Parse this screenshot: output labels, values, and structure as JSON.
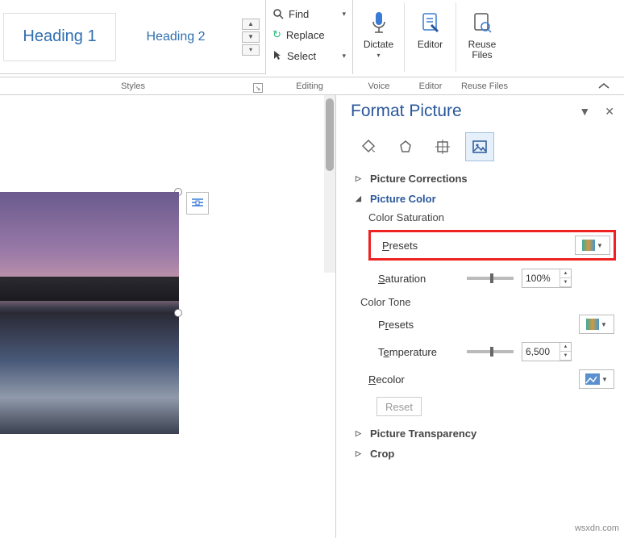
{
  "ribbon": {
    "styles": {
      "heading1": "Heading 1",
      "heading2": "Heading 2",
      "group_label": "Styles"
    },
    "editing": {
      "find": "Find",
      "replace": "Replace",
      "select": "Select",
      "group_label": "Editing"
    },
    "dictate": {
      "label": "Dictate",
      "group_label": "Voice"
    },
    "editor": {
      "label": "Editor",
      "group_label": "Editor"
    },
    "reuse": {
      "label": "Reuse\nFiles",
      "group_label": "Reuse Files"
    }
  },
  "pane": {
    "title": "Format Picture",
    "sections": {
      "corrections": "Picture Corrections",
      "color": {
        "title": "Picture Color",
        "saturation_label": "Color Saturation",
        "presets": "Presets",
        "saturation": "Saturation",
        "saturation_value": "100%",
        "tone_label": "Color Tone",
        "tone_presets": "Presets",
        "temperature": "Temperature",
        "temperature_value": "6,500",
        "recolor": "Recolor",
        "reset": "Reset"
      },
      "transparency": "Picture Transparency",
      "crop": "Crop"
    }
  },
  "watermark": "wsxdn.com"
}
